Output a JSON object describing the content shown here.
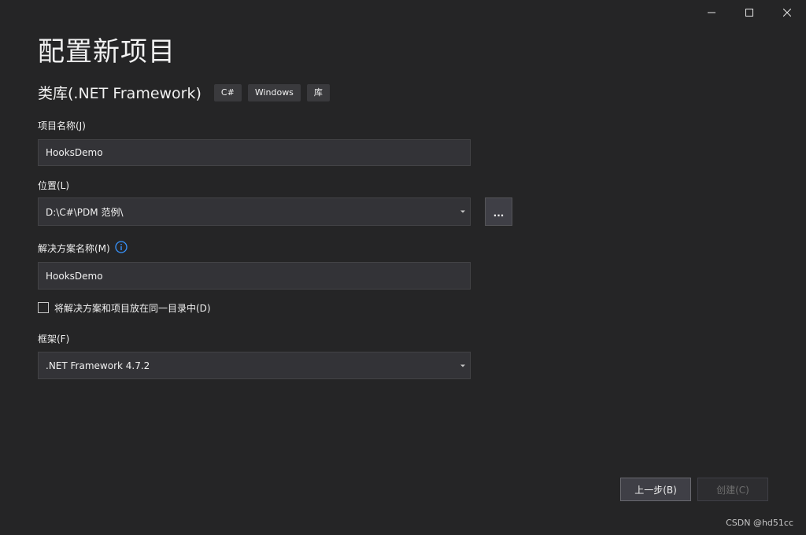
{
  "window": {
    "controls": [
      {
        "name": "minimize-icon",
        "glyph": "—"
      },
      {
        "name": "maximize-icon",
        "glyph": "☐"
      },
      {
        "name": "close-icon",
        "glyph": "✕"
      }
    ]
  },
  "header": {
    "title": "配置新项目",
    "template_name": "类库(.NET Framework)",
    "tags": [
      "C#",
      "Windows",
      "库"
    ]
  },
  "form": {
    "project_name": {
      "label": "项目名称(J)",
      "value": "HooksDemo"
    },
    "location": {
      "label": "位置(L)",
      "value": "D:\\C#\\PDM 范例\\",
      "browse_label": "..."
    },
    "solution_name": {
      "label": "解决方案名称(M)",
      "value": "HooksDemo",
      "info_icon": "info-icon"
    },
    "same_directory": {
      "label": "将解决方案和项目放在同一目录中(D)",
      "checked": false
    },
    "framework": {
      "label": "框架(F)",
      "value": ".NET Framework 4.7.2"
    }
  },
  "footer": {
    "back_label": "上一步(B)",
    "create_label": "创建(C)",
    "watermark": "CSDN @hd51cc"
  },
  "colors": {
    "background": "#252526",
    "field_background": "#333337",
    "info_accent": "#3794ff"
  }
}
